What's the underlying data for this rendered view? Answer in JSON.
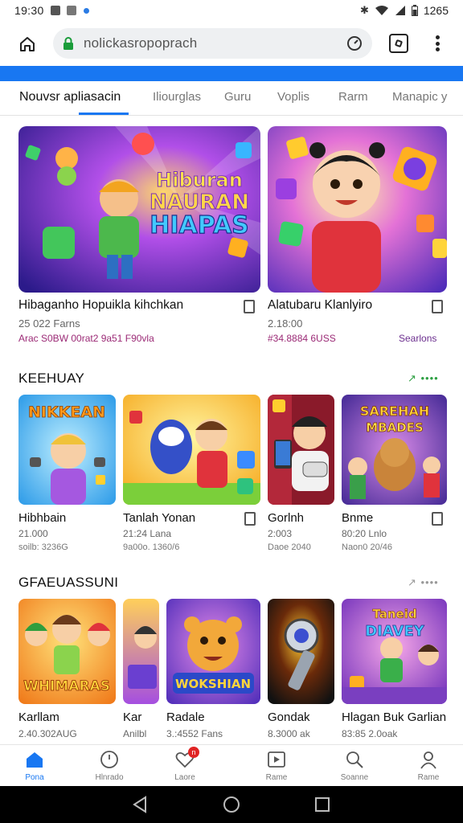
{
  "status": {
    "time": "19:30",
    "battery": "1265"
  },
  "browser": {
    "url": "nolickasropoprach",
    "accent": "#1877f2"
  },
  "tabs": [
    {
      "label": "Nouvsr apliasacin",
      "active": true
    },
    {
      "label": "Iliourglas"
    },
    {
      "label": "Guru"
    },
    {
      "label": "Voplis"
    },
    {
      "label": "Rarm"
    },
    {
      "label": "Manapic y"
    }
  ],
  "featured": [
    {
      "art_text": [
        "Hiburan",
        "NAURAN",
        "HIAPAS"
      ],
      "title": "Hibaganho Hopuikla kihchkan",
      "sub": "25 022 Farns",
      "meta": "Arac S0BW 00rat2 9a51 F90vla"
    },
    {
      "title": "Alatubaru Klanlyiro",
      "sub": "2.18:00",
      "meta": "#34.8884 6USS",
      "meta_right": "Searlons"
    }
  ],
  "sections": [
    {
      "title": "KEEHUAY",
      "more": "↗ ••••",
      "items": [
        {
          "art_text": "NIKKEAN",
          "title": "Hibhbain",
          "sub": "21.000",
          "sub2": "soilb: 3236G"
        },
        {
          "title": "Tanlah Yonan",
          "sub": "21:24 Lana",
          "sub2": "9a00o. 1360/6"
        },
        {
          "title": "Gorlnh",
          "sub": "2:003",
          "sub2": "Daoe 2040"
        },
        {
          "art_text": [
            "SAREHAH",
            "MBADES"
          ],
          "title": "Bnme",
          "sub": "80:20 Lnlo",
          "sub2": "Naon0 20/46"
        }
      ]
    },
    {
      "title": "GFAEUASSUNI",
      "more": "↗ ••••",
      "items": [
        {
          "art_text": "WHIMARAS",
          "title": "Karllam",
          "sub": "2.40.302AUG"
        },
        {
          "title": "Kar",
          "sub": "Anilbl"
        },
        {
          "art_text": "WOKSHIAN",
          "title": "Radale",
          "sub": "3.:4552 Fans"
        },
        {
          "title": "Gondak",
          "sub": "8.3000 ak"
        },
        {
          "art_text": [
            "Taneid",
            "DIAVEY"
          ],
          "title": "Hlagan Buk Garlian",
          "sub": "83:85 2.0oak"
        }
      ]
    }
  ],
  "bottom_nav": [
    {
      "label": "Pona",
      "icon": "home-icon",
      "active": true
    },
    {
      "label": "Hlnrado",
      "icon": "clock-icon"
    },
    {
      "label": "Laore",
      "icon": "heart-icon",
      "badge": "n"
    },
    {
      "label": "Rame",
      "icon": "media-icon"
    },
    {
      "label": "Soanne",
      "icon": "search-icon"
    },
    {
      "label": "Rame",
      "icon": "profile-icon"
    }
  ]
}
